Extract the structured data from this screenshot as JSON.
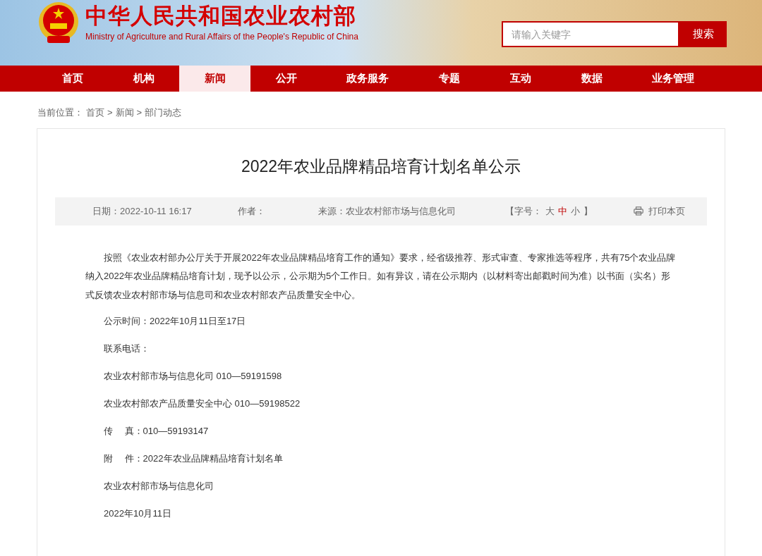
{
  "header": {
    "title": "中华人民共和国农业农村部",
    "subtitle": "Ministry of Agriculture and Rural Affairs of the People's Republic of China",
    "search": {
      "placeholder": "请输入关键字",
      "button": "搜索"
    }
  },
  "nav": [
    {
      "label": "首页",
      "selected": false
    },
    {
      "label": "机构",
      "selected": false
    },
    {
      "label": "新闻",
      "selected": true
    },
    {
      "label": "公开",
      "selected": false
    },
    {
      "label": "政务服务",
      "selected": false
    },
    {
      "label": "专题",
      "selected": false
    },
    {
      "label": "互动",
      "selected": false
    },
    {
      "label": "数据",
      "selected": false
    },
    {
      "label": "业务管理",
      "selected": false
    }
  ],
  "breadcrumb": {
    "label": "当前位置：",
    "items": [
      {
        "text": "首页"
      },
      {
        "separator": ">",
        "text": "新闻"
      },
      {
        "separator": ">",
        "text": "部门动态"
      }
    ]
  },
  "article": {
    "title": "2022年农业品牌精品培育计划名单公示",
    "meta": {
      "date": "日期：2022-10-11 16:17",
      "author": "作者：",
      "source": "来源：农业农村部市场与信息化司",
      "font_size": {
        "open": "【字号：",
        "close": "】",
        "options": [
          {
            "label": "大",
            "selected": false
          },
          {
            "label": "中",
            "selected": true
          },
          {
            "label": "小",
            "selected": false
          }
        ]
      },
      "print": "打印本页"
    },
    "intro": "按照《农业农村部办公厅关于开展2022年农业品牌精品培育工作的通知》要求，经省级推荐、形式审查、专家推选等程序，共有75个农业品牌纳入2022年农业品牌精品培育计划，现予以公示，公示期为5个工作日。如有异议，请在公示期内（以材料寄出邮戳时间为准）以书面（实名）形式反馈农业农村部市场与信息司和农业农村部农产品质量安全中心。",
    "lines": [
      "公示时间：2022年10月11日至17日",
      "联系电话：",
      "农业农村部市场与信息化司 010—59191598",
      "农业农村部农产品质量安全中心 010—59198522",
      "传　 真：010—59193147",
      "附　 件：2022年农业品牌精品培育计划名单",
      "农业农村部市场与信息化司",
      "2022年10月11日"
    ]
  }
}
